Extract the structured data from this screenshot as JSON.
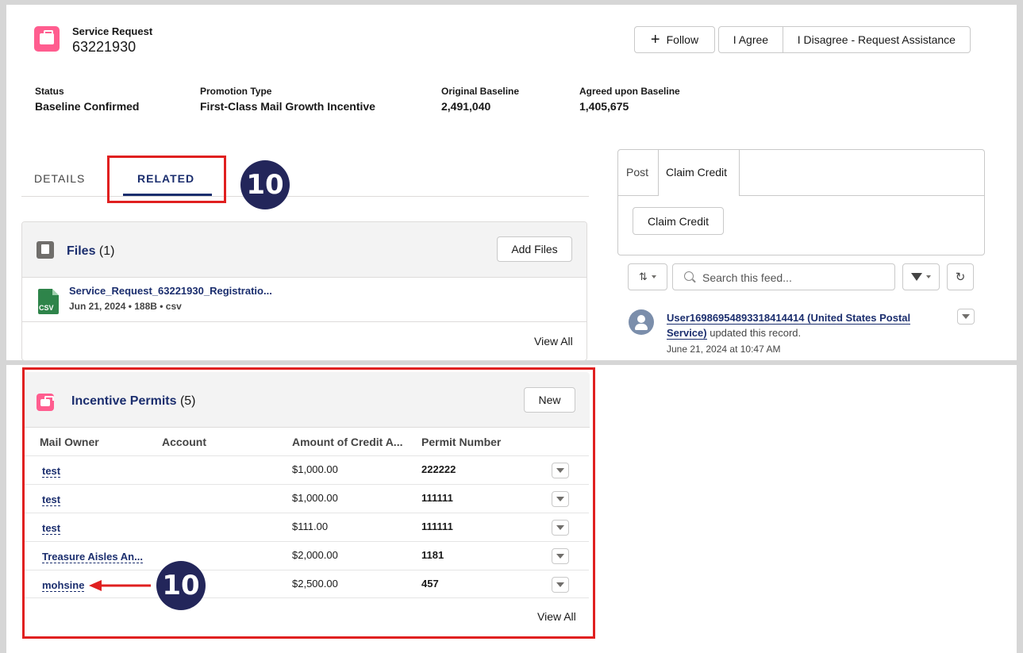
{
  "header": {
    "object_type": "Service Request",
    "record_number": "63221930",
    "buttons": {
      "follow": "Follow",
      "agree": "I Agree",
      "disagree": "I Disagree - Request Assistance"
    }
  },
  "highlights": [
    {
      "label": "Status",
      "value": "Baseline Confirmed"
    },
    {
      "label": "Promotion Type",
      "value": "First-Class Mail Growth Incentive"
    },
    {
      "label": "Original Baseline",
      "value": "2,491,040"
    },
    {
      "label": "Agreed upon Baseline",
      "value": "1,405,675"
    }
  ],
  "tabs": {
    "details": "DETAILS",
    "related": "RELATED",
    "active": "RELATED"
  },
  "callouts": {
    "first": "10",
    "second": "10"
  },
  "files": {
    "title": "Files",
    "count": "(1)",
    "add_button": "Add Files",
    "items": [
      {
        "name": "Service_Request_63221930_Registratio...",
        "meta": "Jun 21, 2024 • 188B • csv",
        "ext": "CSV"
      }
    ],
    "view_all": "View All"
  },
  "feed": {
    "tabs": {
      "post": "Post",
      "claim": "Claim Credit"
    },
    "claim_button": "Claim Credit",
    "search_placeholder": "Search this feed...",
    "item": {
      "user": "User16986954893318414414 (United States Postal Service)",
      "action": "updated this record.",
      "timestamp": "June 21, 2024 at 10:47 AM"
    }
  },
  "incentive_permits": {
    "title": "Incentive Permits",
    "count": "(5)",
    "new_button": "New",
    "columns": [
      "Mail Owner",
      "Account",
      "Amount of Credit A...",
      "Permit Number"
    ],
    "rows": [
      {
        "owner": "test",
        "account": "",
        "amount": "$1,000.00",
        "permit": "222222"
      },
      {
        "owner": "test",
        "account": "",
        "amount": "$1,000.00",
        "permit": "111111"
      },
      {
        "owner": "test",
        "account": "",
        "amount": "$111.00",
        "permit": "111111"
      },
      {
        "owner": "Treasure Aisles An...",
        "account": "",
        "amount": "$2,000.00",
        "permit": "1181"
      },
      {
        "owner": "mohsine",
        "account": "",
        "amount": "$2,500.00",
        "permit": "457"
      }
    ],
    "view_all": "View All"
  },
  "colors": {
    "brand_navy": "#1b2e6e",
    "icon_pink": "#ff5d8f",
    "highlight_red": "#e02020",
    "callout_navy": "#23265a"
  }
}
